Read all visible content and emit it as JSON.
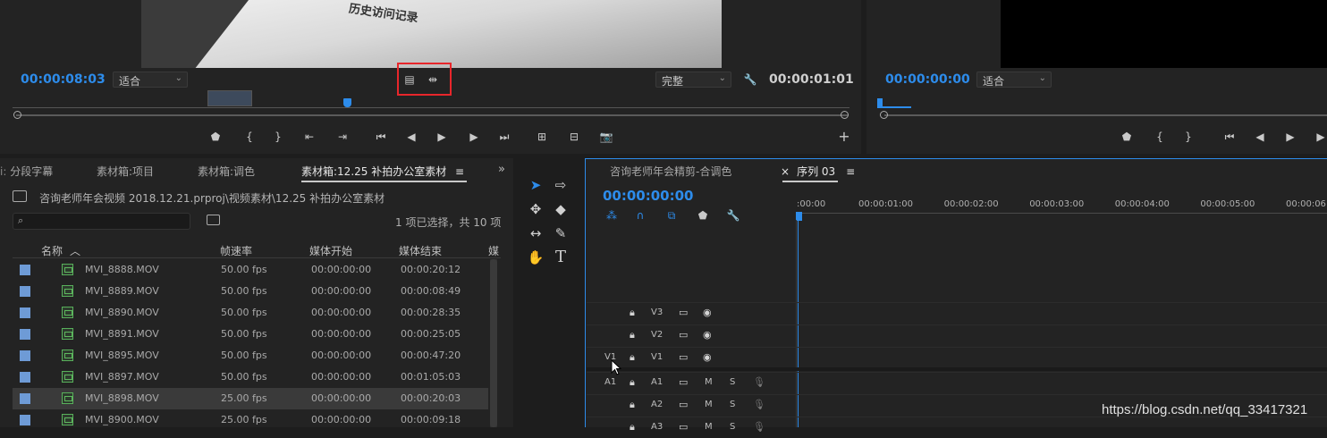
{
  "source_monitor": {
    "timecode_left": "00:00:08:03",
    "fit_select": "适合",
    "quality_select": "完整",
    "timecode_right": "00:00:01:01",
    "video_overlay_text": "历史访问记录"
  },
  "program_monitor": {
    "timecode_left": "00:00:00:00",
    "fit_select": "适合"
  },
  "project_tabs": [
    "分段字幕",
    "素材箱:项目",
    "素材箱:调色",
    "素材箱:12.25 补拍办公室素材"
  ],
  "project": {
    "path": "咨询老师年会视频 2018.12.21.prproj\\视频素材\\12.25 补拍办公室素材",
    "selection_info": "1 项已选择，共 10 项",
    "columns": [
      "名称",
      "帧速率",
      "媒体开始",
      "媒体结束",
      "媒"
    ],
    "rows": [
      {
        "name": "MVI_8888.MOV",
        "fps": "50.00 fps",
        "start": "00:00:00:00",
        "end": "00:00:20:12"
      },
      {
        "name": "MVI_8889.MOV",
        "fps": "50.00 fps",
        "start": "00:00:00:00",
        "end": "00:00:08:49"
      },
      {
        "name": "MVI_8890.MOV",
        "fps": "50.00 fps",
        "start": "00:00:00:00",
        "end": "00:00:28:35"
      },
      {
        "name": "MVI_8891.MOV",
        "fps": "50.00 fps",
        "start": "00:00:00:00",
        "end": "00:00:25:05"
      },
      {
        "name": "MVI_8895.MOV",
        "fps": "50.00 fps",
        "start": "00:00:00:00",
        "end": "00:00:47:20"
      },
      {
        "name": "MVI_8897.MOV",
        "fps": "50.00 fps",
        "start": "00:00:00:00",
        "end": "00:01:05:03"
      },
      {
        "name": "MVI_8898.MOV",
        "fps": "25.00 fps",
        "start": "00:00:00:00",
        "end": "00:00:20:03"
      },
      {
        "name": "MVI_8900.MOV",
        "fps": "25.00 fps",
        "start": "00:00:00:00",
        "end": "00:00:09:18"
      }
    ]
  },
  "timeline": {
    "tab_inactive": "咨询老师年会精剪-合调色",
    "tab_active": "序列 03",
    "close_mark": "×",
    "menu_mark": "≡",
    "timecode": "00:00:00:00",
    "ruler": [
      ":00:00",
      "00:00:01:00",
      "00:00:02:00",
      "00:00:03:00",
      "00:00:04:00",
      "00:00:05:00",
      "00:00:06:"
    ],
    "tracks": [
      {
        "id": "V3",
        "src": "",
        "m": "",
        "s": ""
      },
      {
        "id": "V2",
        "src": "",
        "m": "",
        "s": ""
      },
      {
        "id": "V1",
        "src": "V1",
        "m": "",
        "s": ""
      },
      {
        "id": "A1",
        "src": "A1",
        "m": "M",
        "s": "S"
      },
      {
        "id": "A2",
        "src": "",
        "m": "M",
        "s": "S"
      },
      {
        "id": "A3",
        "src": "",
        "m": "M",
        "s": "S"
      }
    ]
  },
  "watermark": "https://blog.csdn.net/qq_33417321",
  "colors": {
    "accent": "#2d8ceb",
    "highlight_box": "#e8262b"
  }
}
